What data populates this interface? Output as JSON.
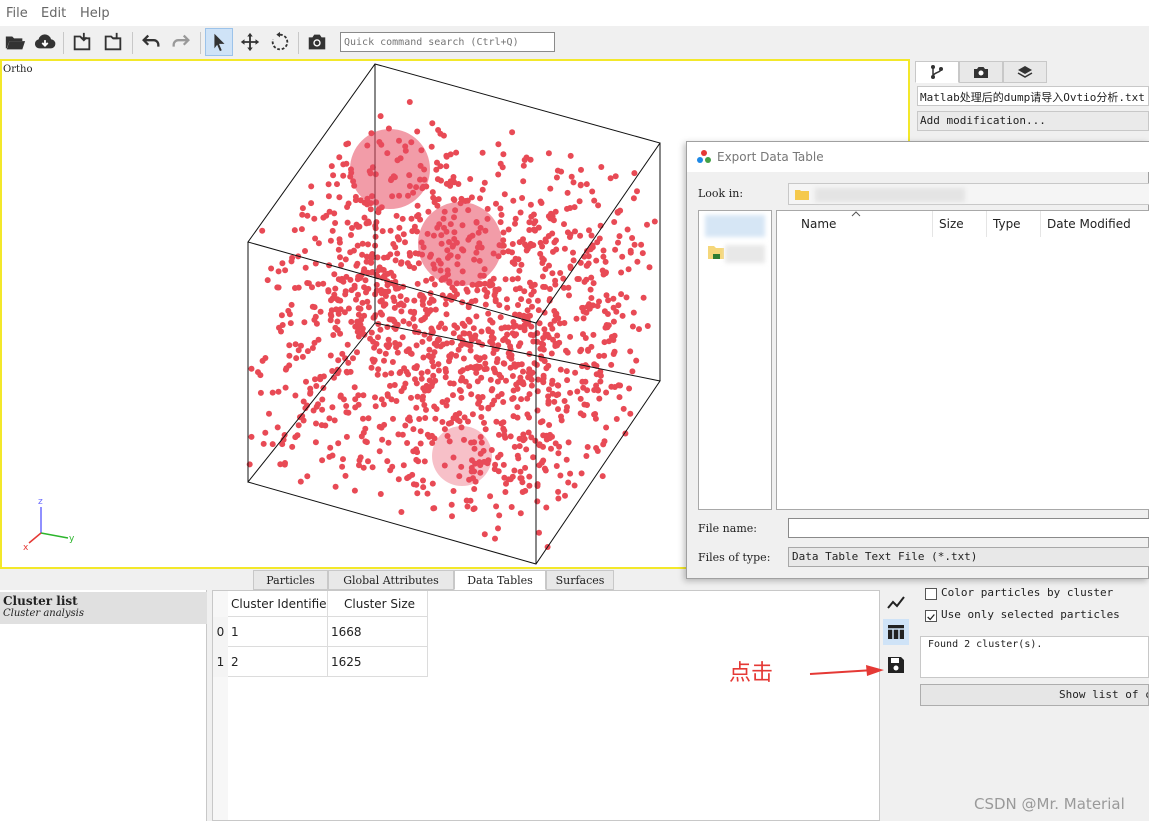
{
  "menu": [
    "File",
    "Edit",
    "Help"
  ],
  "toolbar": {
    "icons": [
      "open-folder-icon",
      "cloud-download-icon",
      "export-icon",
      "export-file-icon",
      "undo-icon",
      "redo-icon",
      "select-cursor-icon",
      "pan-icon",
      "orbit-icon",
      "camera-icon"
    ],
    "search_placeholder": "Quick command search (Ctrl+Q)"
  },
  "viewport": {
    "label": "Ortho",
    "axes": {
      "z": "z",
      "y": "y",
      "x": "x"
    },
    "border_color": "#f3e82a",
    "particle_color": "#e84a55"
  },
  "command_panel": {
    "tabs": [
      "pipeline-icon",
      "render-icon",
      "layers-icon"
    ],
    "pipeline_source": "Matlab处理后的dump请导入Ovtio分析.txt",
    "add_modification": "Add modification...",
    "color_by_cluster": "Color particles by cluster",
    "use_selected": "Use only selected particles",
    "status": "Found 2 cluster(s).",
    "show_list_button": "Show list of cl"
  },
  "bottom_tabs": [
    "Particles",
    "Global Attributes",
    "Data Tables",
    "Surfaces"
  ],
  "left_list": {
    "title": "Cluster list",
    "subtitle": "Cluster analysis"
  },
  "data_table": {
    "headers": [
      "Cluster Identifier",
      "Cluster Size"
    ],
    "row_headers": [
      "0",
      "1"
    ],
    "rows": [
      [
        "1",
        "1668"
      ],
      [
        "2",
        "1625"
      ]
    ]
  },
  "dialog": {
    "title": "Export Data Table",
    "look_in_label": "Look in:",
    "columns": [
      "Name",
      "Size",
      "Type",
      "Date Modified"
    ],
    "file_name_label": "File name:",
    "file_name_value": "",
    "files_of_type_label": "Files of type:",
    "files_of_type_value": "Data Table Text File (*.txt)"
  },
  "annotation": "点击",
  "watermark": "CSDN @Mr. Material",
  "colors": {
    "accent": "#cfe3f7",
    "annotation": "#e53935"
  }
}
